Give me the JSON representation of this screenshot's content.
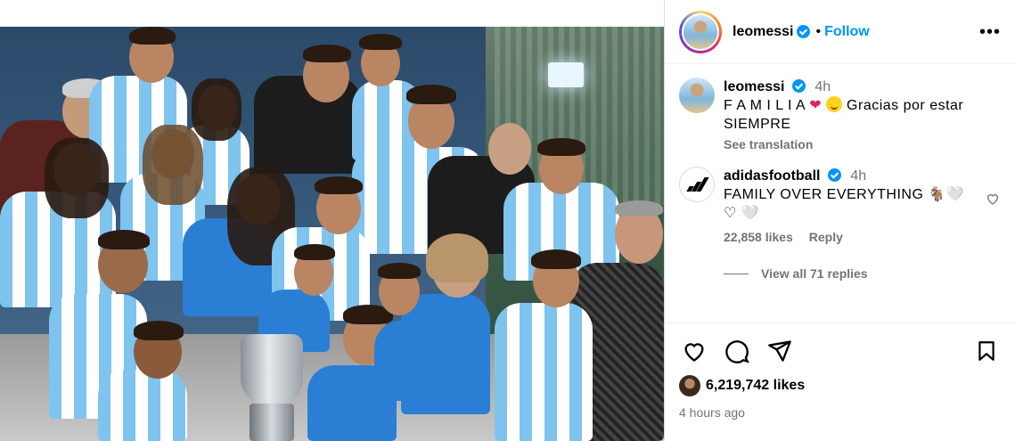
{
  "post": {
    "username": "leomessi",
    "follow_label": "Follow",
    "dot": "•",
    "more_label": "•••",
    "caption": {
      "username": "leomessi",
      "time": "4h",
      "text_part1": "F A M I L I A",
      "text_part2": "Gracias por estar SIEMPRE",
      "see_translation": "See translation"
    },
    "comment": {
      "username": "adidasfootball",
      "time": "4h",
      "text": "FAMILY OVER EVERYTHING 🐐🤍♡ 🤍",
      "likes": "22,858 likes",
      "reply_label": "Reply",
      "view_replies": "View all 71 replies"
    },
    "likes_count": "6,219,742 likes",
    "posted_time": "4 hours ago"
  },
  "icons": {
    "verified": "verified-badge-icon",
    "like": "heart-icon",
    "comment": "comment-icon",
    "share": "send-icon",
    "save": "bookmark-icon",
    "more": "more-icon"
  },
  "colors": {
    "follow_blue": "#0095f6",
    "meta_gray": "#737373",
    "heart_red": "#e0245e"
  }
}
